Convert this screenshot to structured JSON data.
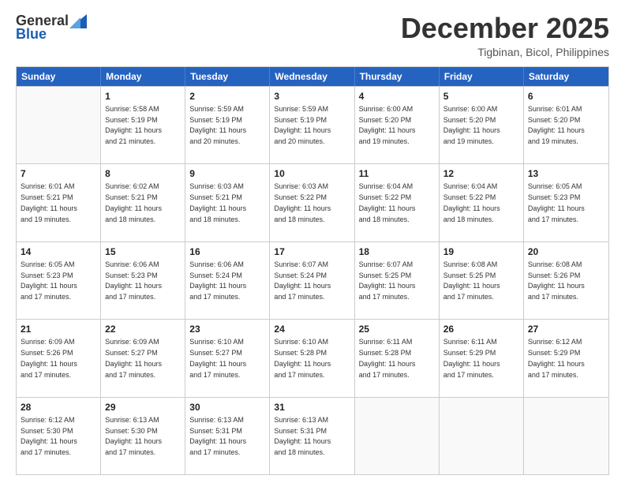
{
  "header": {
    "logo_general": "General",
    "logo_blue": "Blue",
    "month_title": "December 2025",
    "location": "Tigbinan, Bicol, Philippines"
  },
  "calendar": {
    "days_of_week": [
      "Sunday",
      "Monday",
      "Tuesday",
      "Wednesday",
      "Thursday",
      "Friday",
      "Saturday"
    ],
    "rows": [
      [
        {
          "day": "",
          "text": ""
        },
        {
          "day": "1",
          "text": "Sunrise: 5:58 AM\nSunset: 5:19 PM\nDaylight: 11 hours\nand 21 minutes."
        },
        {
          "day": "2",
          "text": "Sunrise: 5:59 AM\nSunset: 5:19 PM\nDaylight: 11 hours\nand 20 minutes."
        },
        {
          "day": "3",
          "text": "Sunrise: 5:59 AM\nSunset: 5:19 PM\nDaylight: 11 hours\nand 20 minutes."
        },
        {
          "day": "4",
          "text": "Sunrise: 6:00 AM\nSunset: 5:20 PM\nDaylight: 11 hours\nand 19 minutes."
        },
        {
          "day": "5",
          "text": "Sunrise: 6:00 AM\nSunset: 5:20 PM\nDaylight: 11 hours\nand 19 minutes."
        },
        {
          "day": "6",
          "text": "Sunrise: 6:01 AM\nSunset: 5:20 PM\nDaylight: 11 hours\nand 19 minutes."
        }
      ],
      [
        {
          "day": "7",
          "text": "Sunrise: 6:01 AM\nSunset: 5:21 PM\nDaylight: 11 hours\nand 19 minutes."
        },
        {
          "day": "8",
          "text": "Sunrise: 6:02 AM\nSunset: 5:21 PM\nDaylight: 11 hours\nand 18 minutes."
        },
        {
          "day": "9",
          "text": "Sunrise: 6:03 AM\nSunset: 5:21 PM\nDaylight: 11 hours\nand 18 minutes."
        },
        {
          "day": "10",
          "text": "Sunrise: 6:03 AM\nSunset: 5:22 PM\nDaylight: 11 hours\nand 18 minutes."
        },
        {
          "day": "11",
          "text": "Sunrise: 6:04 AM\nSunset: 5:22 PM\nDaylight: 11 hours\nand 18 minutes."
        },
        {
          "day": "12",
          "text": "Sunrise: 6:04 AM\nSunset: 5:22 PM\nDaylight: 11 hours\nand 18 minutes."
        },
        {
          "day": "13",
          "text": "Sunrise: 6:05 AM\nSunset: 5:23 PM\nDaylight: 11 hours\nand 17 minutes."
        }
      ],
      [
        {
          "day": "14",
          "text": "Sunrise: 6:05 AM\nSunset: 5:23 PM\nDaylight: 11 hours\nand 17 minutes."
        },
        {
          "day": "15",
          "text": "Sunrise: 6:06 AM\nSunset: 5:23 PM\nDaylight: 11 hours\nand 17 minutes."
        },
        {
          "day": "16",
          "text": "Sunrise: 6:06 AM\nSunset: 5:24 PM\nDaylight: 11 hours\nand 17 minutes."
        },
        {
          "day": "17",
          "text": "Sunrise: 6:07 AM\nSunset: 5:24 PM\nDaylight: 11 hours\nand 17 minutes."
        },
        {
          "day": "18",
          "text": "Sunrise: 6:07 AM\nSunset: 5:25 PM\nDaylight: 11 hours\nand 17 minutes."
        },
        {
          "day": "19",
          "text": "Sunrise: 6:08 AM\nSunset: 5:25 PM\nDaylight: 11 hours\nand 17 minutes."
        },
        {
          "day": "20",
          "text": "Sunrise: 6:08 AM\nSunset: 5:26 PM\nDaylight: 11 hours\nand 17 minutes."
        }
      ],
      [
        {
          "day": "21",
          "text": "Sunrise: 6:09 AM\nSunset: 5:26 PM\nDaylight: 11 hours\nand 17 minutes."
        },
        {
          "day": "22",
          "text": "Sunrise: 6:09 AM\nSunset: 5:27 PM\nDaylight: 11 hours\nand 17 minutes."
        },
        {
          "day": "23",
          "text": "Sunrise: 6:10 AM\nSunset: 5:27 PM\nDaylight: 11 hours\nand 17 minutes."
        },
        {
          "day": "24",
          "text": "Sunrise: 6:10 AM\nSunset: 5:28 PM\nDaylight: 11 hours\nand 17 minutes."
        },
        {
          "day": "25",
          "text": "Sunrise: 6:11 AM\nSunset: 5:28 PM\nDaylight: 11 hours\nand 17 minutes."
        },
        {
          "day": "26",
          "text": "Sunrise: 6:11 AM\nSunset: 5:29 PM\nDaylight: 11 hours\nand 17 minutes."
        },
        {
          "day": "27",
          "text": "Sunrise: 6:12 AM\nSunset: 5:29 PM\nDaylight: 11 hours\nand 17 minutes."
        }
      ],
      [
        {
          "day": "28",
          "text": "Sunrise: 6:12 AM\nSunset: 5:30 PM\nDaylight: 11 hours\nand 17 minutes."
        },
        {
          "day": "29",
          "text": "Sunrise: 6:13 AM\nSunset: 5:30 PM\nDaylight: 11 hours\nand 17 minutes."
        },
        {
          "day": "30",
          "text": "Sunrise: 6:13 AM\nSunset: 5:31 PM\nDaylight: 11 hours\nand 17 minutes."
        },
        {
          "day": "31",
          "text": "Sunrise: 6:13 AM\nSunset: 5:31 PM\nDaylight: 11 hours\nand 18 minutes."
        },
        {
          "day": "",
          "text": ""
        },
        {
          "day": "",
          "text": ""
        },
        {
          "day": "",
          "text": ""
        }
      ]
    ]
  }
}
